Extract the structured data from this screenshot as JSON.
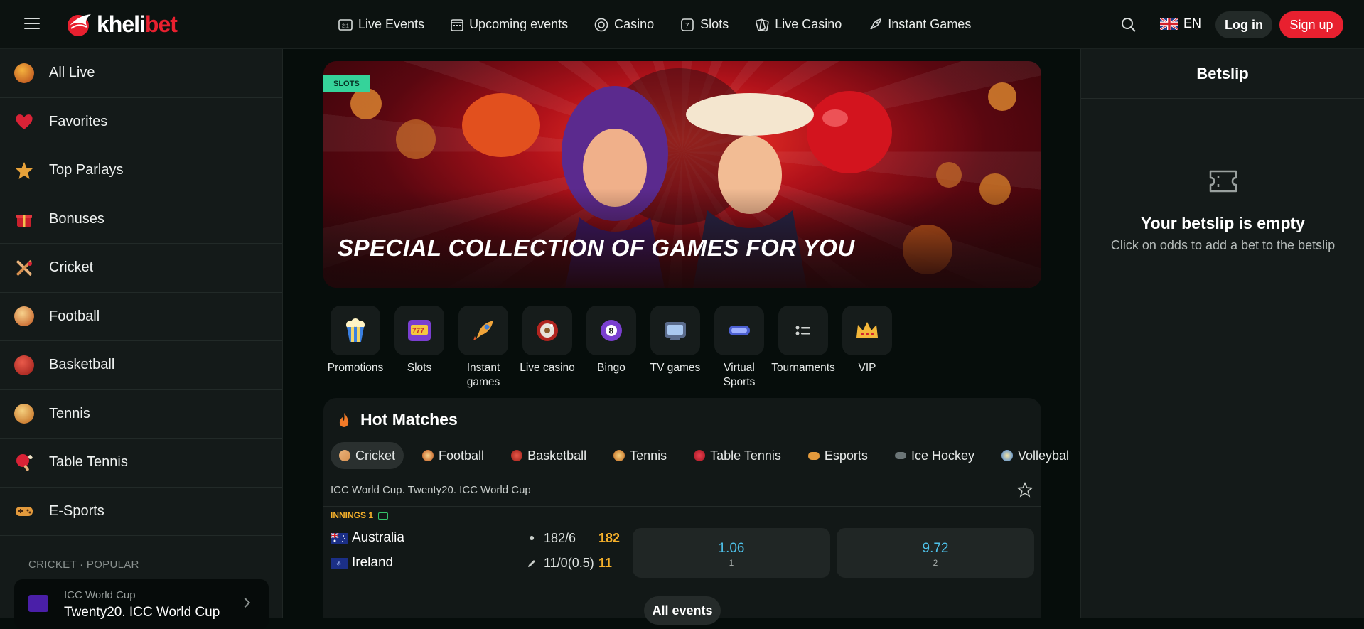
{
  "header": {
    "logo_part1": "kheli",
    "logo_part2": "bet",
    "nav": [
      {
        "label": "Live Events",
        "icon": "scoreboard-icon"
      },
      {
        "label": "Upcoming events",
        "icon": "calendar-icon"
      },
      {
        "label": "Casino",
        "icon": "casino-chip-icon"
      },
      {
        "label": "Slots",
        "icon": "slots-icon"
      },
      {
        "label": "Live Casino",
        "icon": "cards-icon"
      },
      {
        "label": "Instant Games",
        "icon": "rocket-icon"
      }
    ],
    "language": "EN",
    "login_label": "Log in",
    "signup_label": "Sign up"
  },
  "sidebar": {
    "items": [
      {
        "label": "All Live",
        "icon": "live-icon"
      },
      {
        "label": "Favorites",
        "icon": "heart-icon"
      },
      {
        "label": "Top Parlays",
        "icon": "star-icon"
      },
      {
        "label": "Bonuses",
        "icon": "gift-icon"
      },
      {
        "label": "Cricket",
        "icon": "cricket-icon"
      },
      {
        "label": "Football",
        "icon": "football-icon"
      },
      {
        "label": "Basketball",
        "icon": "basketball-icon"
      },
      {
        "label": "Tennis",
        "icon": "tennis-icon"
      },
      {
        "label": "Table Tennis",
        "icon": "table-tennis-icon"
      },
      {
        "label": "E-Sports",
        "icon": "gamepad-icon"
      }
    ],
    "section_title": "CRICKET · POPULAR",
    "popular_card": {
      "line1": "ICC World Cup",
      "line2": "Twenty20. ICC World Cup"
    }
  },
  "banner": {
    "tag": "SLOTS",
    "title": "SPECIAL COLLECTION OF GAMES FOR YOU"
  },
  "categories": [
    {
      "label": "Promotions",
      "icon": "popcorn-icon"
    },
    {
      "label": "Slots",
      "icon": "slot-machine-icon"
    },
    {
      "label": "Instant games",
      "icon": "rocket-icon"
    },
    {
      "label": "Live casino",
      "icon": "roulette-icon"
    },
    {
      "label": "Bingo",
      "icon": "bingo-ball-icon"
    },
    {
      "label": "TV games",
      "icon": "tv-icon"
    },
    {
      "label": "Virtual Sports",
      "icon": "vr-headset-icon"
    },
    {
      "label": "Tournaments",
      "icon": "list-icon"
    },
    {
      "label": "VIP",
      "icon": "crown-icon"
    }
  ],
  "hot_matches": {
    "title": "Hot Matches",
    "tabs": [
      "Cricket",
      "Football",
      "Basketball",
      "Tennis",
      "Table Tennis",
      "Esports",
      "Ice Hockey",
      "Volleybal"
    ],
    "league": "ICC World Cup. Twenty20. ICC World Cup",
    "status": "INNINGS 1",
    "team1": {
      "name": "Australia",
      "score": "182/6",
      "runs": "182"
    },
    "team2": {
      "name": "Ireland",
      "score": "11/0(0.5)",
      "runs": "11"
    },
    "odds": [
      {
        "value": "1.06",
        "label": "1"
      },
      {
        "value": "9.72",
        "label": "2"
      }
    ],
    "all_events_label": "All events"
  },
  "betslip": {
    "title": "Betslip",
    "empty_title": "Your betslip is empty",
    "empty_sub": "Click on odds to add a bet to the betslip"
  },
  "colors": {
    "brand_red": "#e8202f",
    "odds_blue": "#4ec2ea",
    "accent_gold": "#f6b12b",
    "tag_green": "#35d39a"
  }
}
